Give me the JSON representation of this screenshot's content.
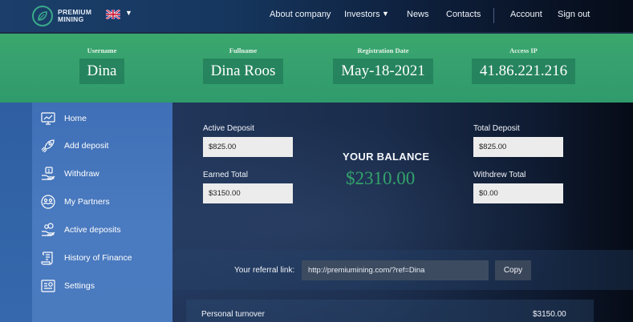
{
  "brand": {
    "line1": "PREMIUM",
    "line2": "MINING"
  },
  "nav": {
    "about": "About company",
    "investors": "Investors",
    "news": "News",
    "contacts": "Contacts",
    "account": "Account",
    "signout": "Sign out"
  },
  "language": {
    "icon": "uk-flag-icon"
  },
  "profile": {
    "username_label": "Username",
    "username": "Dina",
    "fullname_label": "Fullname",
    "fullname": "Dina Roos",
    "regdate_label": "Registration Date",
    "regdate": "May-18-2021",
    "ip_label": "Access IP",
    "ip": "41.86.221.216"
  },
  "sidebar": {
    "items": [
      {
        "label": "Home",
        "icon": "monitor-chart-icon"
      },
      {
        "label": "Add deposit",
        "icon": "rocket-icon"
      },
      {
        "label": "Withdraw",
        "icon": "hand-money-icon"
      },
      {
        "label": "My Partners",
        "icon": "partners-icon"
      },
      {
        "label": "Active deposits",
        "icon": "hand-coins-icon"
      },
      {
        "label": "History of Finance",
        "icon": "scroll-history-icon"
      },
      {
        "label": "Settings",
        "icon": "settings-panel-icon"
      }
    ]
  },
  "balance": {
    "active_deposit_label": "Active Deposit",
    "active_deposit": "$825.00",
    "earned_total_label": "Earned Total",
    "earned_total": "$3150.00",
    "total_deposit_label": "Total Deposit",
    "total_deposit": "$825.00",
    "withdrew_total_label": "Withdrew Total",
    "withdrew_total": "$0.00",
    "title": "YOUR BALANCE",
    "amount": "$2310.00"
  },
  "referral": {
    "label": "Your referral link:",
    "link": "http://premiumining.com/?ref=Dina",
    "copy_label": "Copy"
  },
  "turnover": {
    "label": "Personal turnover",
    "value": "$3150.00"
  },
  "colors": {
    "accent_green": "#33a36b",
    "strip_green": "#36a06f",
    "sidebar_blue": "#4a7abf"
  }
}
